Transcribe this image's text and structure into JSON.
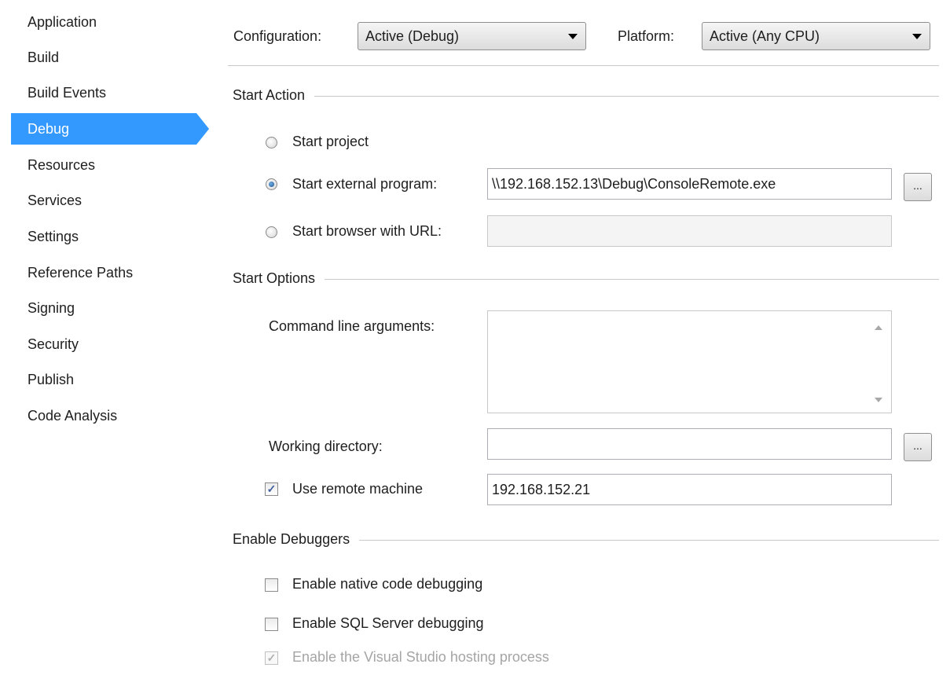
{
  "sidebar": {
    "items": [
      {
        "label": "Application"
      },
      {
        "label": "Build"
      },
      {
        "label": "Build Events"
      },
      {
        "label": "Debug"
      },
      {
        "label": "Resources"
      },
      {
        "label": "Services"
      },
      {
        "label": "Settings"
      },
      {
        "label": "Reference Paths"
      },
      {
        "label": "Signing"
      },
      {
        "label": "Security"
      },
      {
        "label": "Publish"
      },
      {
        "label": "Code Analysis"
      }
    ],
    "selected": "Debug",
    "selected_color": "#3399ff"
  },
  "header": {
    "configuration_label": "Configuration:",
    "configuration_value": "Active (Debug)",
    "platform_label": "Platform:",
    "platform_value": "Active (Any CPU)"
  },
  "start_action": {
    "title": "Start Action",
    "start_project": "Start project",
    "start_external_program": "Start external program:",
    "external_program_path": "\\\\192.168.152.13\\Debug\\ConsoleRemote.exe",
    "start_browser_url": "Start browser with URL:",
    "browser_url_value": "",
    "selected_option": "Start external program:",
    "browse_label": "..."
  },
  "start_options": {
    "title": "Start Options",
    "command_line_label": "Command line arguments:",
    "command_line_value": "",
    "working_directory_label": "Working directory:",
    "working_directory_value": "",
    "use_remote_label": "Use remote machine",
    "use_remote_checked": true,
    "remote_machine_value": "192.168.152.21",
    "browse_label": "..."
  },
  "enable_debuggers": {
    "title": "Enable Debuggers",
    "native": "Enable native code debugging",
    "native_checked": false,
    "sql": "Enable SQL Server debugging",
    "sql_checked": false,
    "hosting": "Enable the Visual Studio hosting process",
    "hosting_checked": true,
    "hosting_enabled": false
  }
}
